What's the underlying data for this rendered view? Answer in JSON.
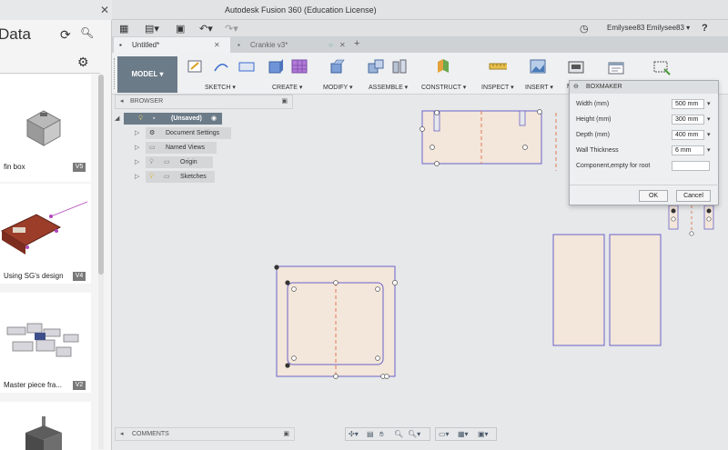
{
  "window": {
    "title": "Autodesk Fusion 360 (Education License)"
  },
  "appbar": {
    "user": "Emilysee83 Emilysee83 ▾",
    "help": "?"
  },
  "tabs": [
    {
      "label": "Untitled*",
      "active": true
    },
    {
      "label": "Crankie v3*",
      "active": false
    }
  ],
  "left_panel": {
    "title": "Data",
    "items": [
      {
        "caption": "fin box",
        "version": "V5"
      },
      {
        "caption": "Using SG's design",
        "version": "V4"
      },
      {
        "caption": "Master piece fra...",
        "version": "V2"
      }
    ]
  },
  "toolbar": {
    "workspace": "MODEL ▾",
    "groups": [
      "SKETCH ▾",
      "CREATE ▾",
      "MODIFY ▾",
      "ASSEMBLE ▾",
      "CONSTRUCT ▾",
      "INSPECT ▾",
      "INSERT ▾",
      "M"
    ]
  },
  "browser": {
    "header": "BROWSER",
    "items": [
      {
        "label": "(Unsaved)"
      },
      {
        "label": "Document Settings"
      },
      {
        "label": "Named Views"
      },
      {
        "label": "Origin"
      },
      {
        "label": "Sketches"
      }
    ]
  },
  "dialog": {
    "title": "BOXMAKER",
    "fields": [
      {
        "label": "Width (mm)",
        "value": "500 mm"
      },
      {
        "label": "Height (mm)",
        "value": "300 mm"
      },
      {
        "label": "Depth (mm)",
        "value": "400 mm"
      },
      {
        "label": "Wall Thickness",
        "value": "6 mm"
      },
      {
        "label": "Component,empty for root",
        "value": ""
      }
    ],
    "ok": "OK",
    "cancel": "Cancel"
  },
  "bottom": {
    "comments": "COMMENTS"
  },
  "colors": {
    "accent": "#6c7b88",
    "sketch_fill": "#f3e6da",
    "sketch_line": "#6a63c9",
    "dash": "#e27b58"
  }
}
